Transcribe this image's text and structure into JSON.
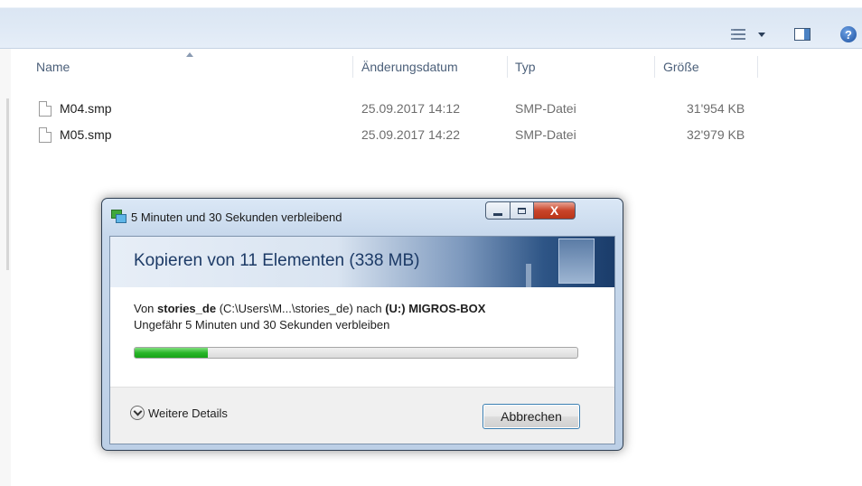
{
  "explorer": {
    "toolbar": {
      "view_icon": "view-list-icon",
      "dropdown_icon": "chevron-down-icon",
      "preview_icon": "preview-pane-icon",
      "help_icon": "help-icon",
      "help_glyph": "?"
    },
    "columns": [
      "Name",
      "Änderungsdatum",
      "Typ",
      "Größe"
    ],
    "files": [
      {
        "name": "M04.smp",
        "date": "25.09.2017 14:12",
        "type": "SMP-Datei",
        "size": "31'954 KB"
      },
      {
        "name": "M05.smp",
        "date": "25.09.2017 14:22",
        "type": "SMP-Datei",
        "size": "32'979 KB"
      }
    ]
  },
  "dialog": {
    "title": "5 Minuten und 30 Sekunden verbleibend",
    "close_glyph": "X",
    "heading": "Kopieren von 11 Elementen (338 MB)",
    "from_prefix": "Von ",
    "source_name": "stories_de",
    "source_path": " (C:\\Users\\M...\\stories_de)  nach ",
    "dest_name": "(U:) MIGROS-BOX",
    "time_remaining": "Ungefähr 5 Minuten und 30 Sekunden verbleiben",
    "progress_percent": 16.5,
    "progress_color": "#2ab52a",
    "details_label": "Weitere Details",
    "cancel_label": "Abbrechen"
  }
}
